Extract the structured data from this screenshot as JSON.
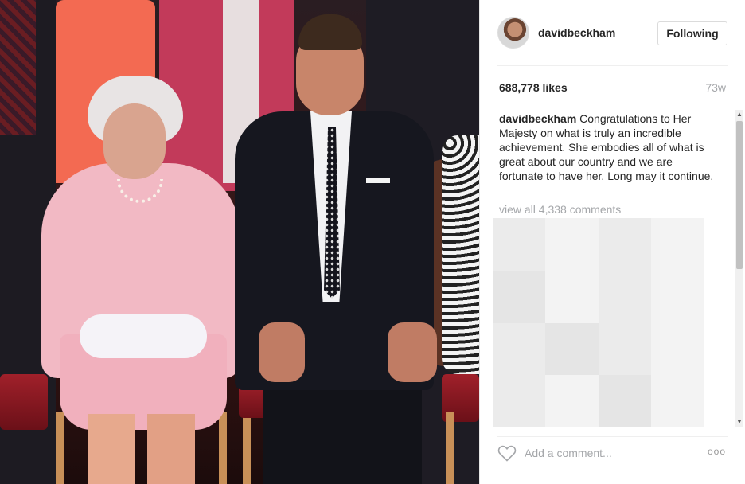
{
  "post": {
    "username": "davidbeckham",
    "follow_label": "Following",
    "likes": "688,778 likes",
    "age": "73w",
    "caption_user": "davidbeckham",
    "caption_text": " Congratulations to Her Majesty on what is truly an incredible achievement. She embodies all of what is great about our country and we are fortunate to have her. Long may it continue.",
    "view_all": "view all 4,338 comments",
    "comment_placeholder": "Add a comment...",
    "more": "ooo"
  },
  "icons": {
    "heart": "heart-icon",
    "more": "more-options-icon",
    "avatar": "avatar"
  },
  "colors": {
    "text": "#262626",
    "muted": "#a5a7aa",
    "border": "#dbdbdb"
  }
}
